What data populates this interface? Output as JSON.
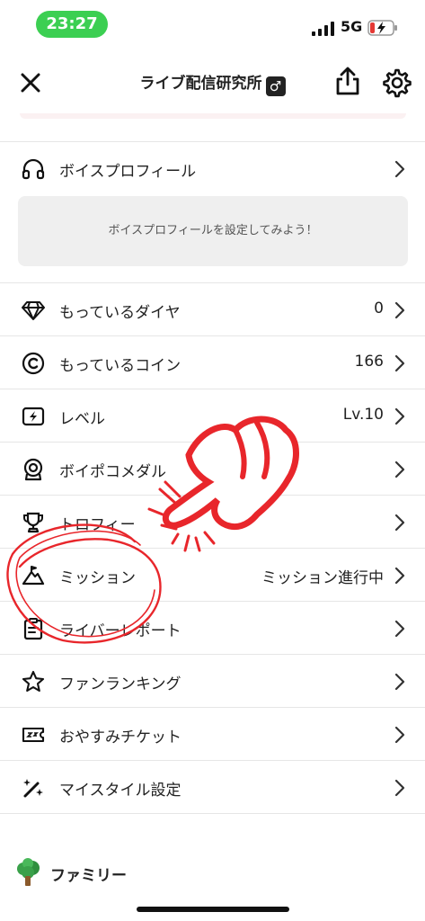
{
  "status_bar": {
    "time": "23:27",
    "network": "5G"
  },
  "header": {
    "title": "ライブ配信研究所",
    "gender_symbol": "♂"
  },
  "voice_profile": {
    "label": "ボイスプロフィール",
    "placeholder": "ボイスプロフィールを設定してみよう！"
  },
  "menu": [
    {
      "label": "もっているダイヤ",
      "value": "0",
      "icon": "diamond-icon"
    },
    {
      "label": "もっているコイン",
      "value": "166",
      "icon": "coin-icon"
    },
    {
      "label": "レベル",
      "value": "Lv.10",
      "icon": "level-icon"
    },
    {
      "label": "ボイポコメダル",
      "value": "",
      "icon": "medal-icon"
    },
    {
      "label": "トロフィー",
      "value": "",
      "icon": "trophy-icon"
    },
    {
      "label": "ミッション",
      "value": "ミッション進行中",
      "icon": "mission-icon"
    },
    {
      "label": "ライバーレポート",
      "value": "",
      "icon": "report-icon"
    },
    {
      "label": "ファンランキング",
      "value": "",
      "icon": "star-icon"
    },
    {
      "label": "おやすみチケット",
      "value": "",
      "icon": "ticket-icon"
    },
    {
      "label": "マイスタイル設定",
      "value": "",
      "icon": "style-icon"
    }
  ],
  "family": {
    "label": "ファミリー",
    "icon": "tree-icon"
  },
  "colors": {
    "time_pill": "#3ccf52",
    "annotation_red": "#e8262b",
    "battery_red": "#e53935"
  }
}
